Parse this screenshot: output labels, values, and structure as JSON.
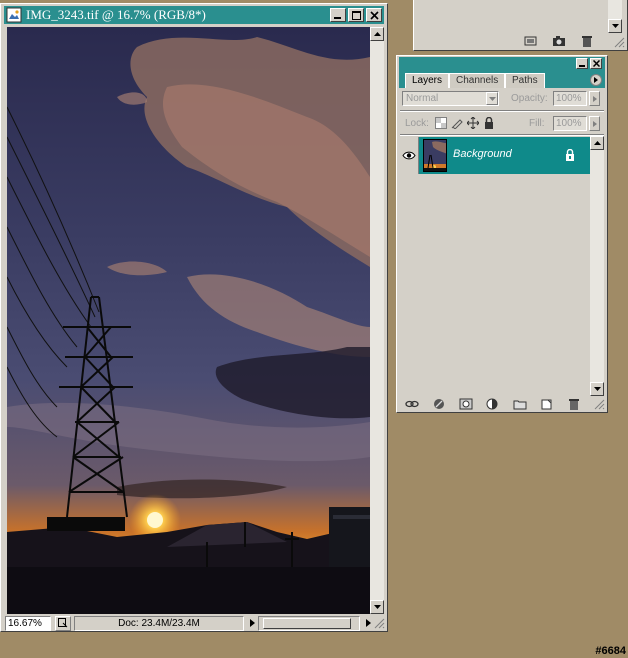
{
  "document": {
    "title": "IMG_3243.tif @ 16.7% (RGB/8*)",
    "zoom": "16.67%",
    "doc_info": "Doc: 23.4M/23.4M"
  },
  "layers_panel": {
    "tabs": [
      "Layers",
      "Channels",
      "Paths"
    ],
    "blend_mode": "Normal",
    "opacity_label": "Opacity:",
    "opacity_value": "100%",
    "lock_label": "Lock:",
    "fill_label": "Fill:",
    "fill_value": "100%",
    "layer_name": "Background"
  },
  "watermark": "#6684",
  "colors": {
    "title_bar": "#2a8f8f",
    "selected_layer": "#0f8a8a",
    "desktop": "#a08b66",
    "chrome": "#d4d0c8"
  }
}
